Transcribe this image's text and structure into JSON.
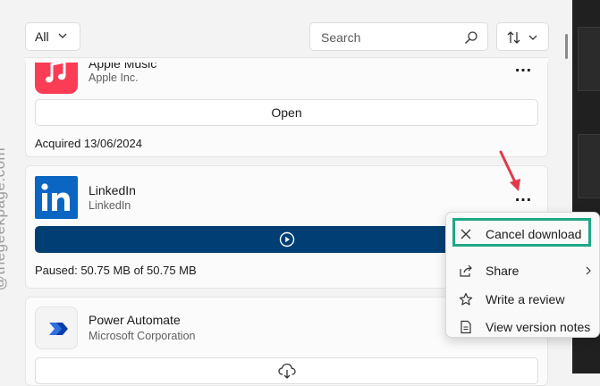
{
  "toolbar": {
    "filter_label": "All",
    "search_placeholder": "Search"
  },
  "apps": [
    {
      "name": "Apple Music",
      "publisher": "Apple Inc.",
      "action_label": "Open",
      "status": "Acquired 13/06/2024"
    },
    {
      "name": "LinkedIn",
      "publisher": "LinkedIn",
      "status": "Paused: 50.75 MB of 50.75 MB"
    },
    {
      "name": "Power Automate",
      "publisher": "Microsoft Corporation"
    }
  ],
  "context_menu": {
    "items": [
      {
        "label": "Cancel download",
        "icon": "close-icon"
      },
      {
        "label": "Share",
        "icon": "share-icon"
      },
      {
        "label": "Write a review",
        "icon": "star-icon"
      },
      {
        "label": "View version notes",
        "icon": "document-icon"
      }
    ]
  },
  "watermark": "@thegeekpage.com",
  "colors": {
    "linkedin_blue": "#0a66c2",
    "download_bar": "#003e73",
    "highlight_border": "#1ea885",
    "annotation_arrow": "#e03a4a"
  }
}
